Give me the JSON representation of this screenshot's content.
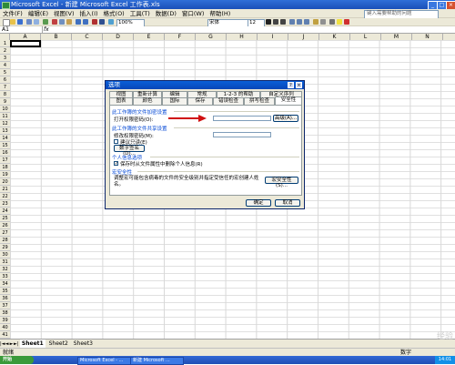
{
  "window": {
    "title": "Microsoft Excel - 新建 Microsoft Excel 工作表.xls",
    "min": "_",
    "max": "□",
    "close": "×"
  },
  "menu": {
    "items": [
      "文件(F)",
      "编辑(E)",
      "视图(V)",
      "插入(I)",
      "格式(O)",
      "工具(T)",
      "数据(D)",
      "窗口(W)",
      "帮助(H)"
    ],
    "help_placeholder": "键入需要帮助的问题"
  },
  "toolbar": {
    "zoom": "100%",
    "font": "宋体",
    "size": "12"
  },
  "formula_bar": {
    "name_box": "A1",
    "fx": "fx",
    "value": ""
  },
  "grid": {
    "columns": [
      "A",
      "B",
      "C",
      "D",
      "E",
      "F",
      "G",
      "H",
      "I",
      "J",
      "K",
      "L",
      "M",
      "N"
    ],
    "rows": [
      "1",
      "2",
      "3",
      "4",
      "5",
      "6",
      "7",
      "8",
      "9",
      "10",
      "11",
      "12",
      "13",
      "14",
      "15",
      "16",
      "17",
      "18",
      "19",
      "20",
      "21",
      "22",
      "23",
      "24",
      "25",
      "26",
      "27",
      "28",
      "29",
      "30",
      "31",
      "32",
      "33",
      "34",
      "35",
      "36",
      "37",
      "38",
      "39",
      "40",
      "41"
    ]
  },
  "sheet_tabs": {
    "nav": [
      "|◄",
      "◄",
      "►",
      "►|"
    ],
    "tabs": [
      "Sheet1",
      "Sheet2",
      "Sheet3"
    ]
  },
  "status": {
    "left": "就绪",
    "right": "数字"
  },
  "taskbar": {
    "start": "开始",
    "items": [
      "Microsoft Excel - ...",
      "新建 Microsoft ..."
    ],
    "clock": "14:01"
  },
  "dialog": {
    "title": "选项",
    "help_btn": "?",
    "close_btn": "×",
    "tabs_row1": [
      "视图",
      "重新计算",
      "编辑",
      "常规",
      "1-2-3 的帮助",
      "自定义序列"
    ],
    "tabs_row2": [
      "图表",
      "颜色",
      "国际",
      "保存",
      "错误检查",
      "拼写检查",
      "安全性"
    ],
    "encrypt_section": "此工作簿的文件加密设置",
    "open_password_label": "打开权限密码(O):",
    "advanced_btn": "高级(A)...",
    "share_section": "此工作簿的文件共享设置",
    "modify_password_label": "修改权限密码(M):",
    "readonly_label": "建议只读(E)",
    "signature_btn": "数字签名(D)...",
    "privacy_section": "个人信息选项",
    "privacy_label": "保存时从文件属性中删除个人信息(R)",
    "macro_section": "宏安全性",
    "macro_desc": "调整宏可能包含病毒的文件的安全级别并指定受信任的宏创建人姓名。",
    "macro_btn": "宏安全性(S)...",
    "ok": "确定",
    "cancel": "取消"
  },
  "watermark": "经验"
}
